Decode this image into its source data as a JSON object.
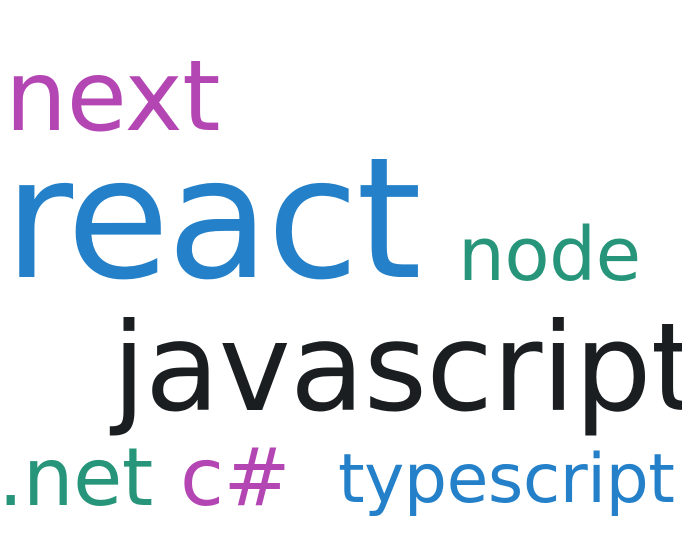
{
  "words": [
    {
      "text": "next",
      "color": "#b446b4"
    },
    {
      "text": "react",
      "color": "#2480c8"
    },
    {
      "text": "node",
      "color": "#27957a"
    },
    {
      "text": "javascript",
      "color": "#1b1e20"
    },
    {
      "text": ".net",
      "color": "#27957a"
    },
    {
      "text": "c#",
      "color": "#b446b4"
    },
    {
      "text": "typescript",
      "color": "#2480c8"
    }
  ]
}
